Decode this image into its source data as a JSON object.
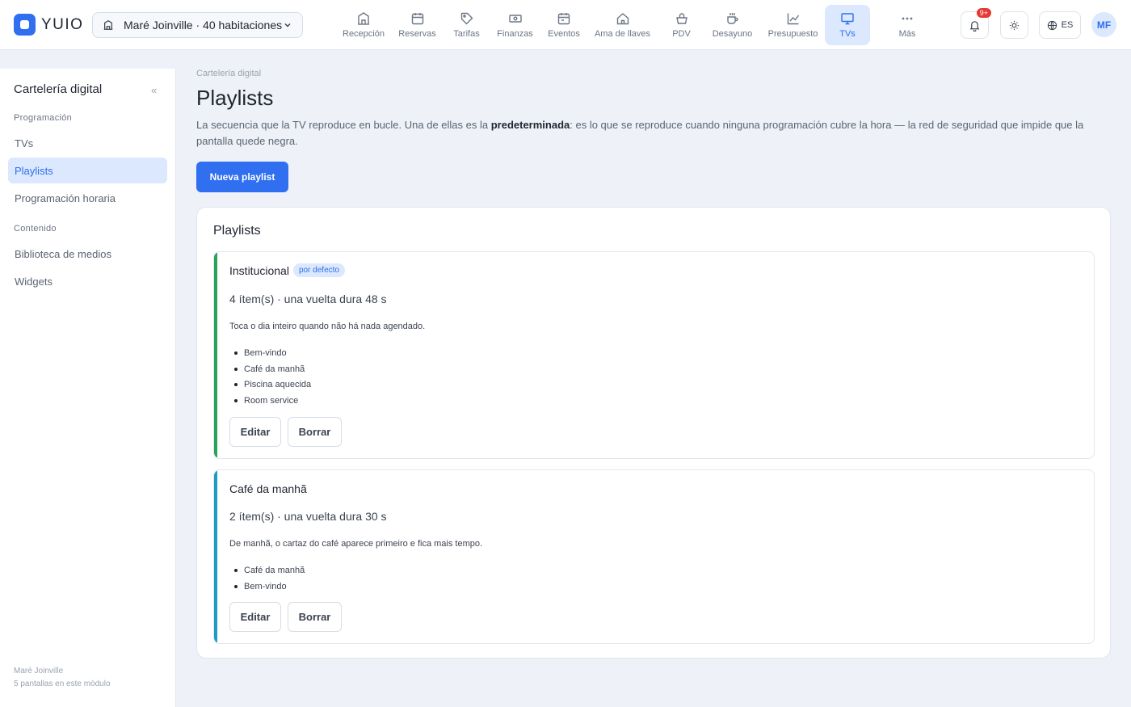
{
  "brand": {
    "name": "YUIO"
  },
  "property": {
    "label": "Maré Joinville · 40 habitaciones"
  },
  "nav": [
    {
      "label": "Recepción",
      "icon": "building-icon"
    },
    {
      "label": "Reservas",
      "icon": "calendar-icon"
    },
    {
      "label": "Tarifas",
      "icon": "tag-icon"
    },
    {
      "label": "Finanzas",
      "icon": "banknote-icon"
    },
    {
      "label": "Eventos",
      "icon": "calendar-event-icon"
    },
    {
      "label": "Ama de llaves",
      "icon": "home-icon"
    },
    {
      "label": "PDV",
      "icon": "basket-icon"
    },
    {
      "label": "Desayuno",
      "icon": "coffee-icon"
    },
    {
      "label": "Presupuesto",
      "icon": "chart-line-icon"
    },
    {
      "label": "TVs",
      "icon": "monitor-icon",
      "active": true
    },
    {
      "label": "Más",
      "icon": "more-icon"
    }
  ],
  "header": {
    "notifications_badge": "9+",
    "language": "ES",
    "avatar_initials": "MF"
  },
  "sidebar": {
    "title": "Cartelería digital",
    "collapse_label": "«",
    "sections": [
      {
        "title": "Programación",
        "items": [
          {
            "label": "TVs"
          },
          {
            "label": "Playlists",
            "active": true
          },
          {
            "label": "Programación horaria"
          }
        ]
      },
      {
        "title": "Contenido",
        "items": [
          {
            "label": "Biblioteca de medios"
          },
          {
            "label": "Widgets"
          }
        ]
      }
    ],
    "footer": {
      "property": "Maré Joinville",
      "screens": "5 pantallas en este módulo"
    }
  },
  "main": {
    "breadcrumb": "Cartelería digital",
    "title": "Playlists",
    "description_before": "La secuencia que la TV reproduce en bucle. Una de ellas es la ",
    "description_bold": "predeterminada",
    "description_after": ": es lo que se reproduce cuando ninguna programación cubre la hora — la red de seguridad que impide que la pantalla quede negra.",
    "new_button": "Nueva playlist",
    "panel_title": "Playlists",
    "playlists": [
      {
        "name": "Institucional",
        "badge": "por defecto",
        "meta": "4 ítem(s) · una vuelta dura 48 s",
        "description": "Toca o dia inteiro quando não há nada agendado.",
        "items": [
          "Bem-vindo",
          "Café da manhã",
          "Piscina aquecida",
          "Room service"
        ],
        "accent": "#27a35a",
        "edit_label": "Editar",
        "delete_label": "Borrar"
      },
      {
        "name": "Café da manhã",
        "meta": "2 ítem(s) · una vuelta dura 30 s",
        "description": "De manhã, o cartaz do café aparece primeiro e fica mais tempo.",
        "items": [
          "Café da manhã",
          "Bem-vindo"
        ],
        "accent": "#1e9bc2",
        "edit_label": "Editar",
        "delete_label": "Borrar"
      }
    ]
  }
}
